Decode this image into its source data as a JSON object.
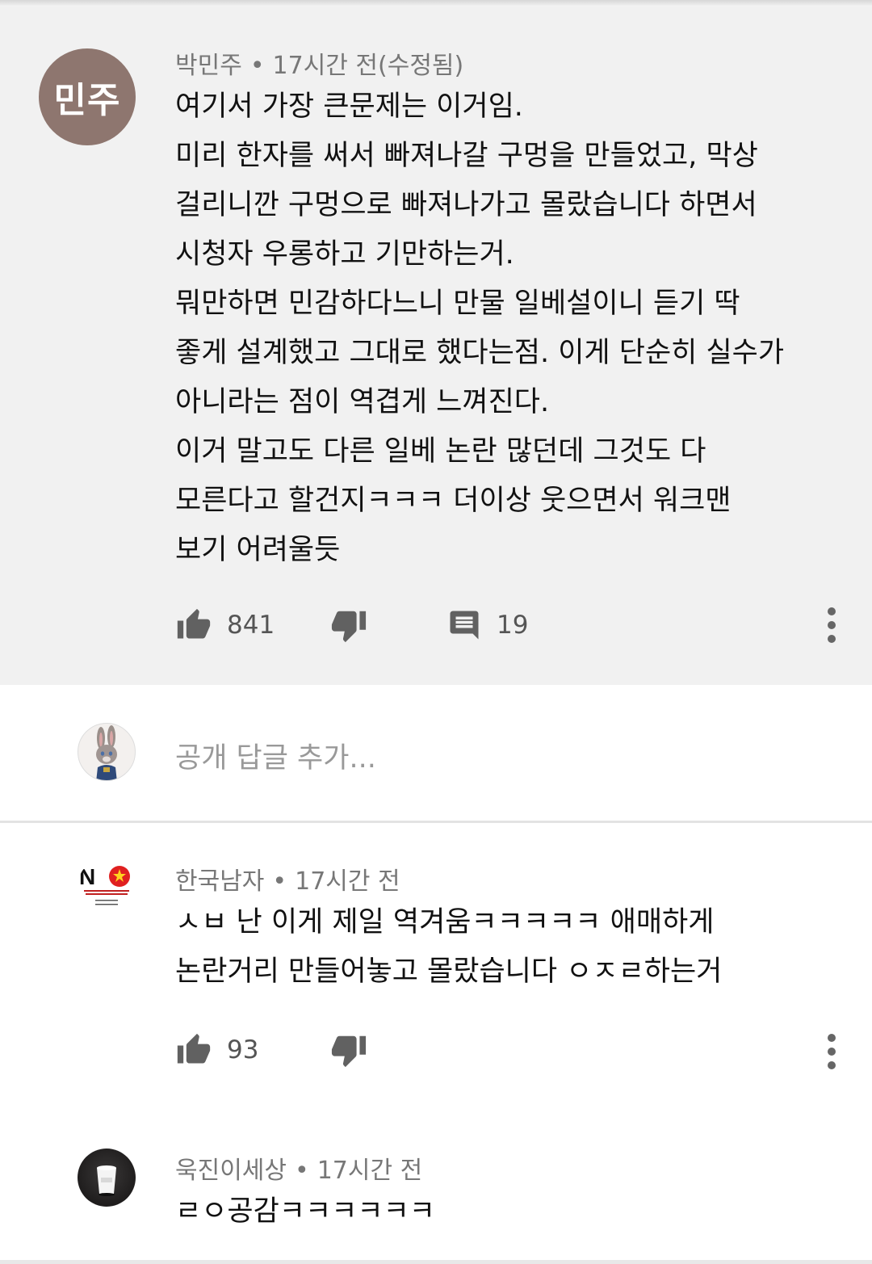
{
  "comment1": {
    "avatar_text": "민주",
    "author": "박민주",
    "time": "17시간 전(수정됨)",
    "lines": [
      "여기서 가장 큰문제는 이거임.",
      "미리 한자를 써서 빠져나갈 구멍을 만들었고, 막상",
      "걸리니깐 구멍으로 빠져나가고 몰랐습니다 하면서",
      "시청자 우롱하고 기만하는거.",
      "뭐만하면 민감하다느니 만물 일베설이니 듣기 딱",
      "좋게 설계했고 그대로 했다는점. 이게 단순히 실수가",
      "아니라는 점이 역겹게 느껴진다.",
      "이거 말고도 다른 일베 논란 많던데 그것도 다",
      "모른다고 할건지ㅋㅋㅋ 더이상 웃으면서 워크맨",
      "보기 어려울듯"
    ],
    "likes": "841",
    "replies": "19"
  },
  "reply_input": {
    "placeholder": "공개 답글 추가..."
  },
  "comment2": {
    "author": "한국남자",
    "time": "17시간 전",
    "lines": [
      "ㅅㅂ 난 이게 제일 역겨움ㅋㅋㅋㅋㅋ 애매하게",
      "논란거리 만들어놓고 몰랐습니다 ㅇㅈㄹ하는거"
    ],
    "likes": "93",
    "logo_text": "NO",
    "logo_subtext": "BOYCOTT CHINA CORONA VIRUS"
  },
  "comment3": {
    "author": "욱진이세상",
    "time": "17시간 전",
    "lines": [
      "ㄹㅇ공감ㅋㅋㅋㅋㅋㅋ"
    ]
  },
  "colors": {
    "avatar_brown": "#8e766f",
    "highlight_bg": "#f1f1f1",
    "meta_gray": "#777777",
    "icon_gray": "#616161"
  },
  "icons": [
    "thumbs-up-icon",
    "thumbs-down-icon",
    "comment-icon",
    "more-vert-icon"
  ]
}
